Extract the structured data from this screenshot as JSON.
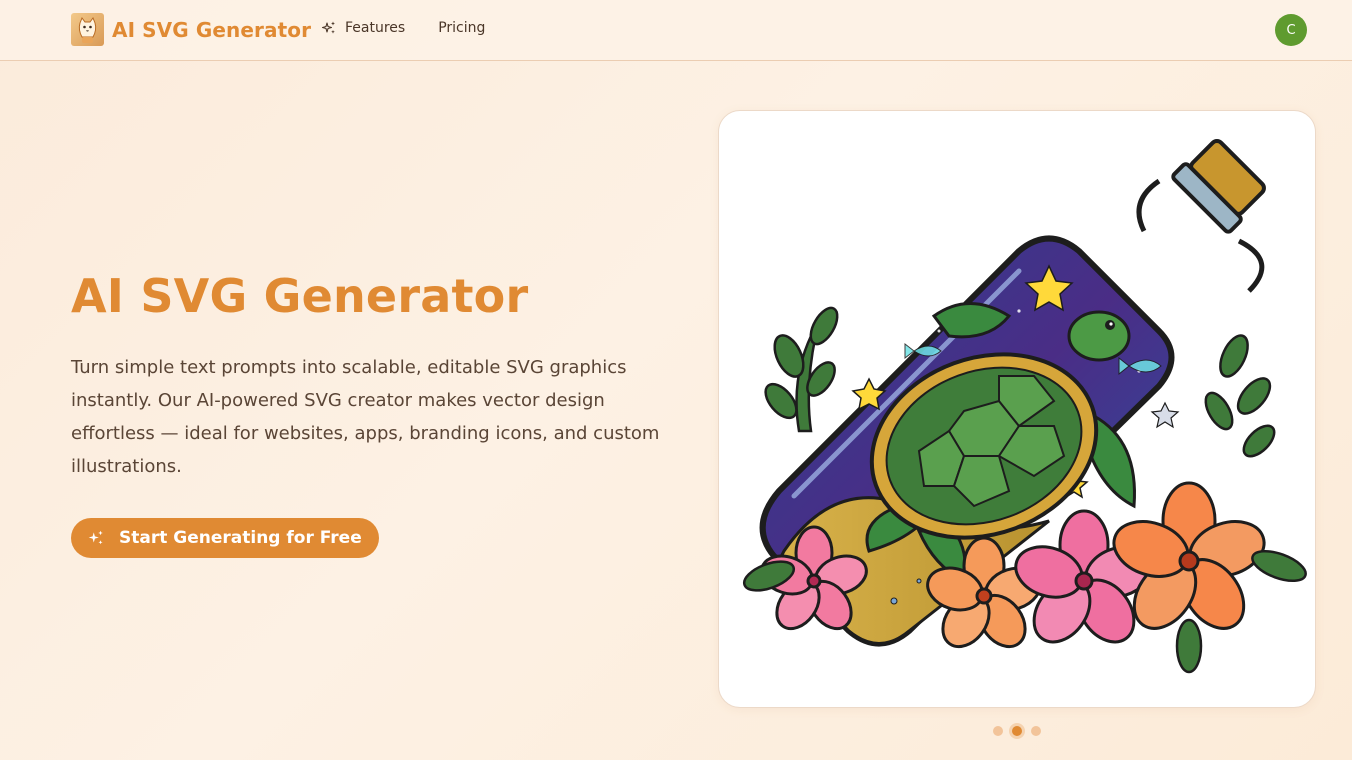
{
  "header": {
    "brand": "AI SVG Generator",
    "logo_icon": "cat-mascot-icon",
    "nav": [
      {
        "label": "Features",
        "icon": "sparkles-icon"
      },
      {
        "label": "Pricing"
      }
    ],
    "avatar_initial": "C",
    "avatar_color": "#5f9b2f"
  },
  "hero": {
    "title": "AI SVG Generator",
    "description": "Turn simple text prompts into scalable, editable SVG graphics instantly. Our AI-powered SVG creator makes vector design effortless — ideal for websites, apps, branding icons, and custom illustrations.",
    "cta_label": "Start Generating for Free",
    "cta_icon": "sparkles-icon"
  },
  "showcase": {
    "image": "sea-turtle-in-bottle-illustration",
    "carousel_total": 3,
    "carousel_active": 2
  },
  "colors": {
    "accent": "#e08a33",
    "background": "#fdf1e4",
    "text": "#4a3628"
  }
}
